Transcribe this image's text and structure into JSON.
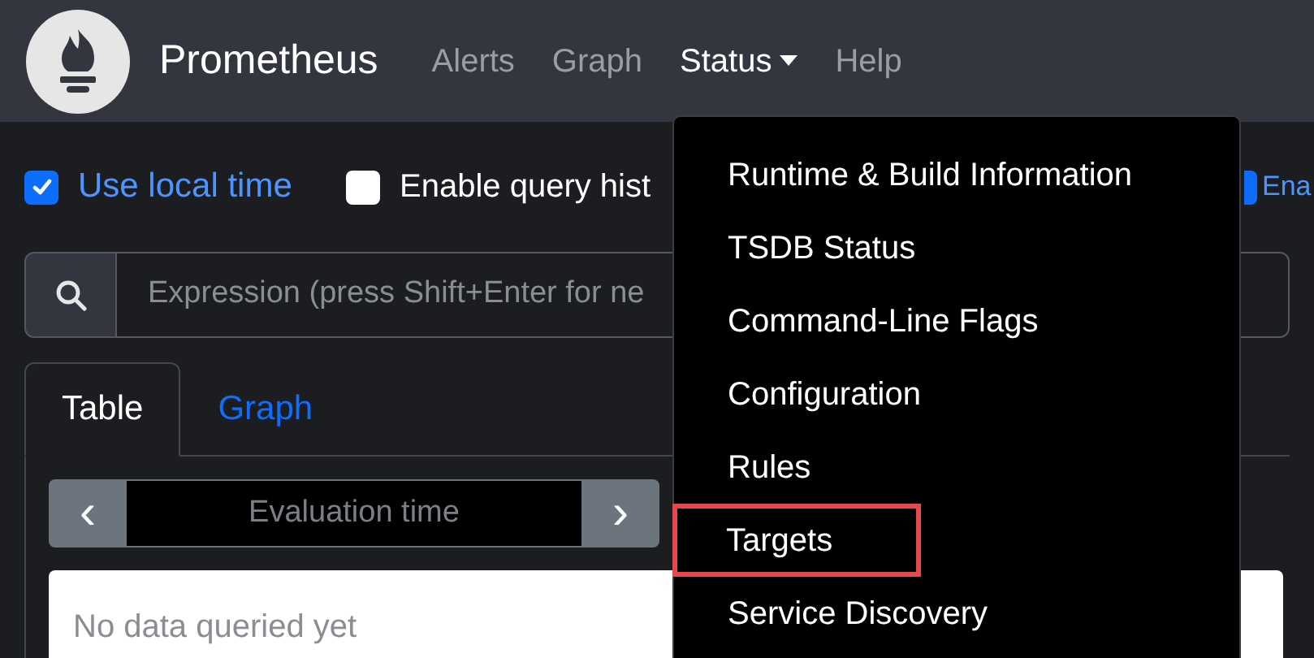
{
  "navbar": {
    "brand": "Prometheus",
    "links": [
      {
        "label": "Alerts",
        "selected": false,
        "caret": false
      },
      {
        "label": "Graph",
        "selected": false,
        "caret": false
      },
      {
        "label": "Status",
        "selected": true,
        "caret": true
      },
      {
        "label": "Help",
        "selected": false,
        "caret": false
      }
    ]
  },
  "options": [
    {
      "label": "Use local time",
      "checked": true
    },
    {
      "label": "Enable query hist",
      "checked": false
    },
    {
      "label": "Ena",
      "checked": true
    }
  ],
  "search": {
    "placeholder": "Expression (press Shift+Enter for ne"
  },
  "tabs": [
    {
      "label": "Table",
      "selected": true
    },
    {
      "label": "Graph",
      "selected": false
    }
  ],
  "evaluation": {
    "prev": "‹",
    "placeholder": "Evaluation time",
    "next": "›"
  },
  "result": {
    "message": "No data queried yet"
  },
  "status_menu": {
    "items": [
      {
        "label": "Runtime & Build Information",
        "highlighted": false
      },
      {
        "label": "TSDB Status",
        "highlighted": false
      },
      {
        "label": "Command-Line Flags",
        "highlighted": false
      },
      {
        "label": "Configuration",
        "highlighted": false
      },
      {
        "label": "Rules",
        "highlighted": false
      },
      {
        "label": "Targets",
        "highlighted": true
      },
      {
        "label": "Service Discovery",
        "highlighted": false
      }
    ]
  }
}
